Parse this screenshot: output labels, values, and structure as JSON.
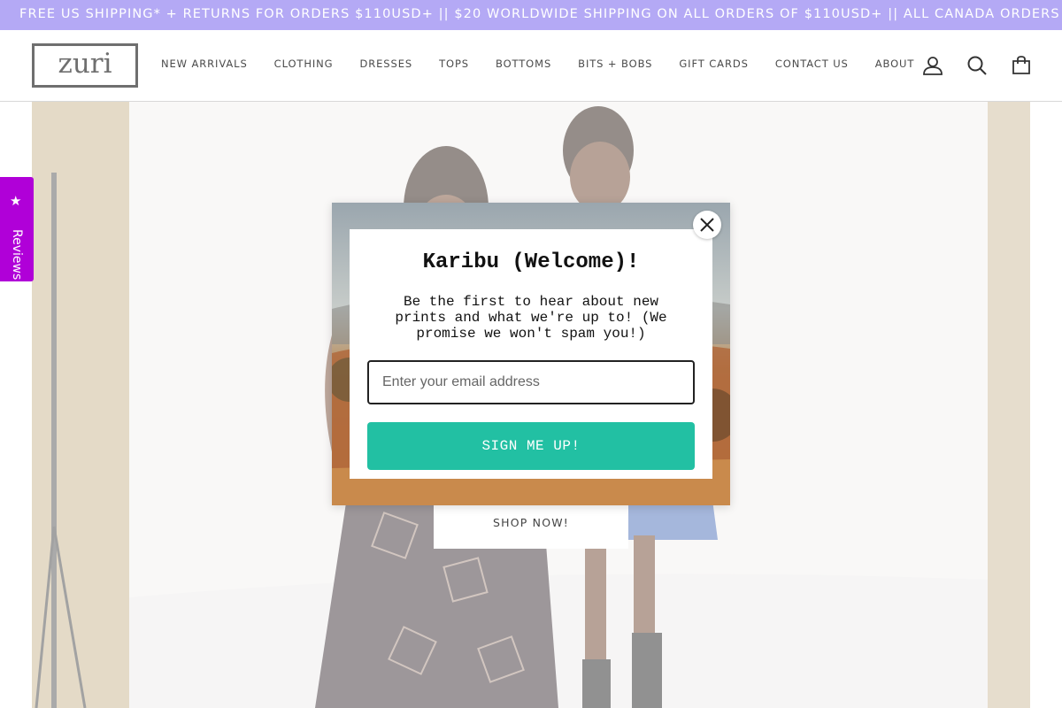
{
  "announcement": {
    "text": "FREE US SHIPPING* + RETURNS FOR ORDERS $110USD+ || $20 WORLDWIDE SHIPPING ON ALL ORDERS OF $110USD+ || ALL CANADA ORDERS SHIP DUTY FREE",
    "bg_color": "#b4a9f5"
  },
  "header": {
    "logo_text": "zuri",
    "nav": [
      {
        "label": "NEW ARRIVALS"
      },
      {
        "label": "CLOTHING"
      },
      {
        "label": "DRESSES"
      },
      {
        "label": "TOPS"
      },
      {
        "label": "BOTTOMS"
      },
      {
        "label": "BITS + BOBS"
      },
      {
        "label": "GIFT CARDS"
      },
      {
        "label": "CONTACT US"
      },
      {
        "label": "ABOUT"
      }
    ],
    "icons": [
      "account-icon",
      "search-icon",
      "cart-icon"
    ]
  },
  "hero": {
    "cta_label": "SHOP NOW!"
  },
  "reviews_tab": {
    "label": "Reviews",
    "icon": "star-icon",
    "bg_color": "#b000d8"
  },
  "popup": {
    "title": "Karibu (Welcome)!",
    "body": "Be the first to hear about new prints and what we're up to! (We promise we won't spam you!)",
    "email_placeholder": "Enter your email address",
    "email_value": "",
    "submit_label": "SIGN ME UP!",
    "submit_color": "#22c0a3",
    "close_icon": "close-icon"
  }
}
